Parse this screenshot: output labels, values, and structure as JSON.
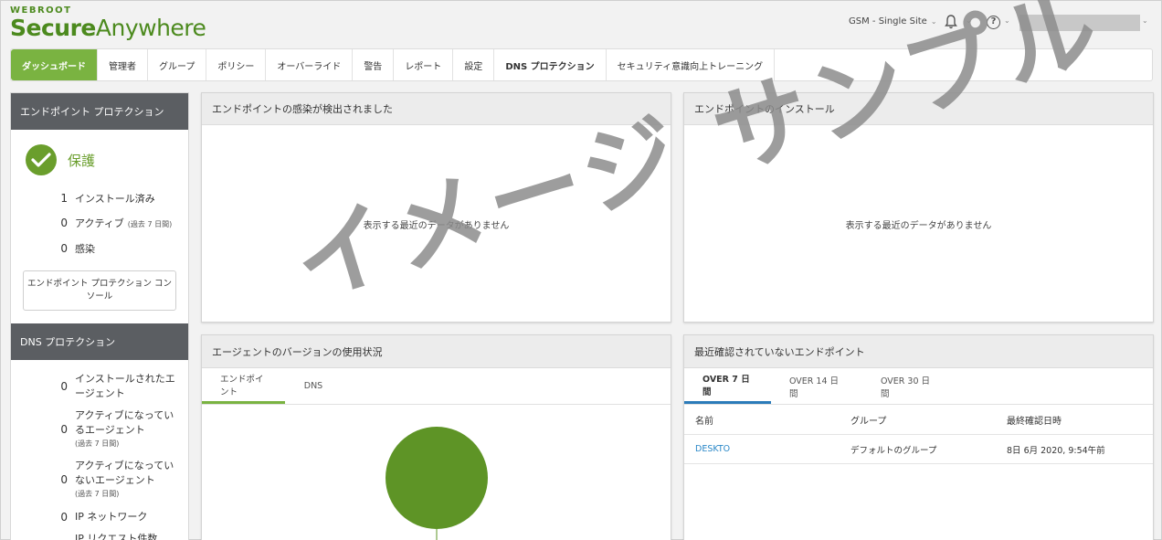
{
  "header": {
    "logo_top": "WEBROOT",
    "logo_bold": "Secure",
    "logo_light": "Anywhere",
    "site": "GSM - Single Site",
    "help_symbol": "?"
  },
  "nav": [
    {
      "label": "ダッシュボード",
      "active": true
    },
    {
      "label": "管理者"
    },
    {
      "label": "グループ"
    },
    {
      "label": "ポリシー"
    },
    {
      "label": "オーバーライド"
    },
    {
      "label": "警告"
    },
    {
      "label": "レポート"
    },
    {
      "label": "設定"
    },
    {
      "label": "DNS プロテクション"
    },
    {
      "label": "セキュリティ意識向上トレーニング"
    }
  ],
  "endpoint_protection": {
    "title": "エンドポイント プロテクション",
    "status": "保護",
    "stats": [
      {
        "value": "1",
        "label": "インストール済み",
        "sub": ""
      },
      {
        "value": "0",
        "label": "アクティブ",
        "sub": "(過去 7 日間)"
      },
      {
        "value": "0",
        "label": "感染",
        "sub": ""
      }
    ],
    "console_button": "エンドポイント プロテクション コンソール"
  },
  "dns_protection": {
    "title": "DNS プロテクション",
    "stats": [
      {
        "value": "0",
        "label": "インストールされたエージェント",
        "sub": ""
      },
      {
        "value": "0",
        "label": "アクティブになっているエージェント",
        "sub": "(過去 7 日間)"
      },
      {
        "value": "0",
        "label": "アクティブになっていないエージェント",
        "sub": "(過去 7 日間)"
      },
      {
        "value": "0",
        "label": "IP ネットワーク",
        "sub": ""
      },
      {
        "value": "",
        "label": "IP リクエスト件数",
        "sub": ""
      }
    ]
  },
  "cards": {
    "infections": {
      "title": "エンドポイントの感染が検出されました",
      "empty": "表示する最近のデータがありません"
    },
    "installs": {
      "title": "エンドポイントのインストール",
      "empty": "表示する最近のデータがありません"
    },
    "agent_versions": {
      "title": "エージェントのバージョンの使用状況",
      "tabs": [
        "エンドポイント",
        "DNS"
      ]
    },
    "not_seen": {
      "title": "最近確認されていないエンドポイント",
      "tabs": [
        "OVER 7 日間",
        "OVER 14 日間",
        "OVER 30 日間"
      ],
      "columns": [
        "名前",
        "グループ",
        "最終確認日時"
      ],
      "rows": [
        {
          "name": "DESKTO",
          "group": "デフォルトのグループ",
          "last_seen": "8日 6月 2020, 9:54午前"
        }
      ]
    }
  },
  "watermark": "イメージ サンプル",
  "colors": {
    "brand_green": "#7ab341",
    "logo_green": "#4c8a1e",
    "sidebar_header": "#5b5e62",
    "link": "#2b88c8",
    "tab_blue": "#2b7bb9",
    "pie_green": "#5e9426"
  }
}
